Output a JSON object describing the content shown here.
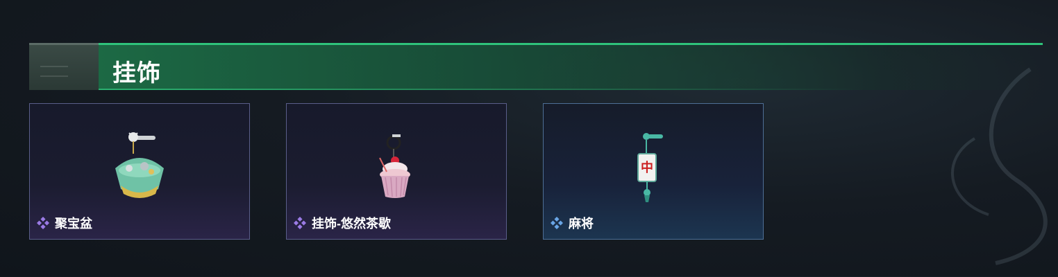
{
  "section": {
    "title": "挂饰"
  },
  "items": [
    {
      "name": "聚宝盆",
      "rarity": "purple",
      "icon": "treasure-bowl-charm-icon"
    },
    {
      "name": "挂饰-悠然茶歇",
      "rarity": "purple",
      "icon": "cupcake-charm-icon"
    },
    {
      "name": "麻将",
      "rarity": "blue",
      "icon": "mahjong-tile-charm-icon"
    }
  ],
  "colors": {
    "accent_green": "#2fc37b",
    "rarity_purple": "#9b7be6",
    "rarity_blue": "#6aa6e6",
    "card_border": "#5a5e8a"
  }
}
